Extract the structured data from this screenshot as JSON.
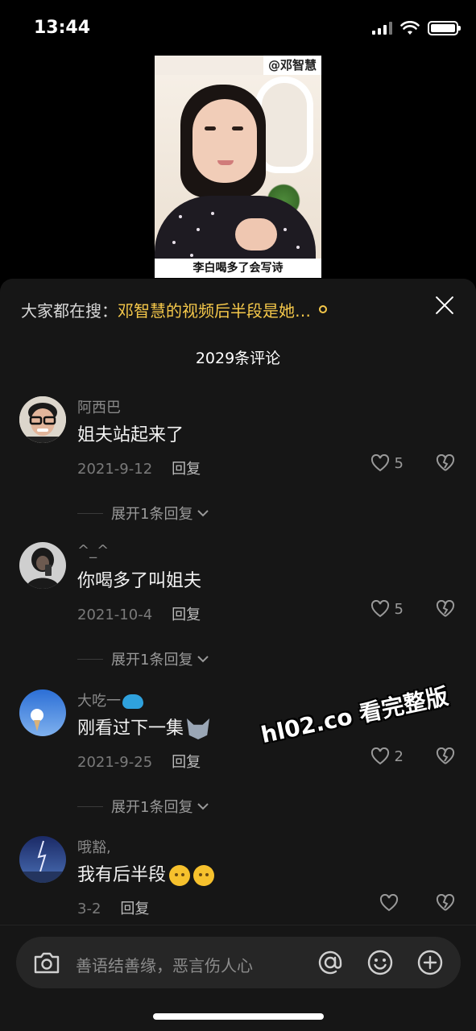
{
  "status_bar": {
    "time": "13:44"
  },
  "video": {
    "tag": "@邓智慧",
    "caption": "李白喝多了会写诗"
  },
  "search_hint": {
    "prefix": "大家都在搜：",
    "keyword": "邓智慧的视频后半段是她…"
  },
  "comments_header": {
    "count_label": "2029条评论"
  },
  "comments": [
    {
      "username": "阿西巴",
      "text": "姐夫站起来了",
      "date": "2021-9-12",
      "reply_label": "回复",
      "likes": "5",
      "expand_label": "展开1条回复"
    },
    {
      "username": "^_^",
      "text": "你喝多了叫姐夫",
      "date": "2021-10-4",
      "reply_label": "回复",
      "likes": "5",
      "expand_label": "展开1条回复"
    },
    {
      "username": "大吃一",
      "text": "刚看过下一集",
      "date": "2021-9-25",
      "reply_label": "回复",
      "likes": "2",
      "expand_label": "展开1条回复"
    },
    {
      "username": "哦豁,",
      "text": "我有后半段",
      "date": "3-2",
      "reply_label": "回复",
      "likes": ""
    }
  ],
  "watermark": "hl02.co 看完整版",
  "input_bar": {
    "placeholder": "善语结善缘，恶言伤人心"
  },
  "colors": {
    "accent": "#f5c84a",
    "panel_bg": "#161616",
    "input_bg": "#262626"
  },
  "icons": [
    "camera-icon",
    "at-icon",
    "emoji-icon",
    "plus-icon",
    "heart-icon",
    "broken-heart-icon",
    "close-icon",
    "search-icon"
  ]
}
